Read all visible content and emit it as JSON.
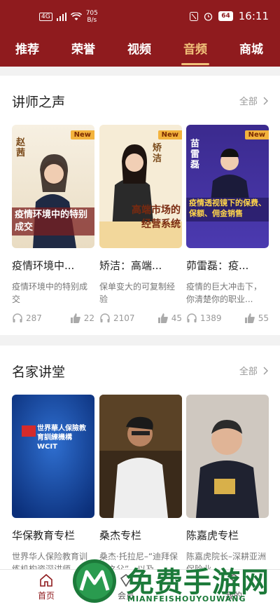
{
  "status_bar": {
    "network": "4G",
    "speed": "705",
    "speed_unit": "B/s",
    "battery": "64",
    "time": "16:11"
  },
  "nav": {
    "tabs": [
      {
        "label": "推荐"
      },
      {
        "label": "荣誉"
      },
      {
        "label": "视频"
      },
      {
        "label": "音频",
        "active": true
      },
      {
        "label": "商城"
      }
    ]
  },
  "sections": [
    {
      "title": "讲师之声",
      "more": "全部",
      "cards": [
        {
          "thumb_name": "赵茜",
          "thumb_caption": "疫情环境中的特别成交",
          "badge": "New",
          "title": "疫情环境中...",
          "desc": "疫情环境中的特别成交",
          "plays": "287",
          "likes": "22"
        },
        {
          "thumb_name": "矫洁",
          "thumb_caption": "高端市场的经营系统",
          "badge": "New",
          "title": "矫洁：高端...",
          "desc": "保单变大的可复制经验",
          "plays": "2107",
          "likes": "45"
        },
        {
          "thumb_name": "苗雷磊",
          "thumb_caption": "疫情透视镜下的保费、保额、佣金销售",
          "badge": "New",
          "title": "茆雷磊：疫...",
          "desc": "疫情的巨大冲击下，你清楚你的职业...",
          "plays": "1389",
          "likes": "55"
        }
      ]
    },
    {
      "title": "名家讲堂",
      "more": "全部",
      "cards": [
        {
          "thumb_caption": "世界華人保險教育訓練機構 WCIT",
          "title": "华保教育专栏",
          "desc": "世界华人保险教育训练机构资深讲师"
        },
        {
          "title": "桑杰专栏",
          "desc": "桑杰·托拉尼–“迪拜保险之父”，以及..."
        },
        {
          "title": "陈嘉虎专栏",
          "desc": "陈嘉虎院长–深耕亚洲保险业..."
        }
      ]
    }
  ],
  "bottom_tabs": [
    {
      "label": "首页",
      "active": true
    },
    {
      "label": "会员"
    },
    {
      "label": "我的"
    }
  ],
  "watermark": {
    "text": "免费手游网",
    "sub": "MIANFEISHOUYOUWANG"
  },
  "colors": {
    "brand": "#8f1b1e",
    "accent": "#f1c27a"
  }
}
